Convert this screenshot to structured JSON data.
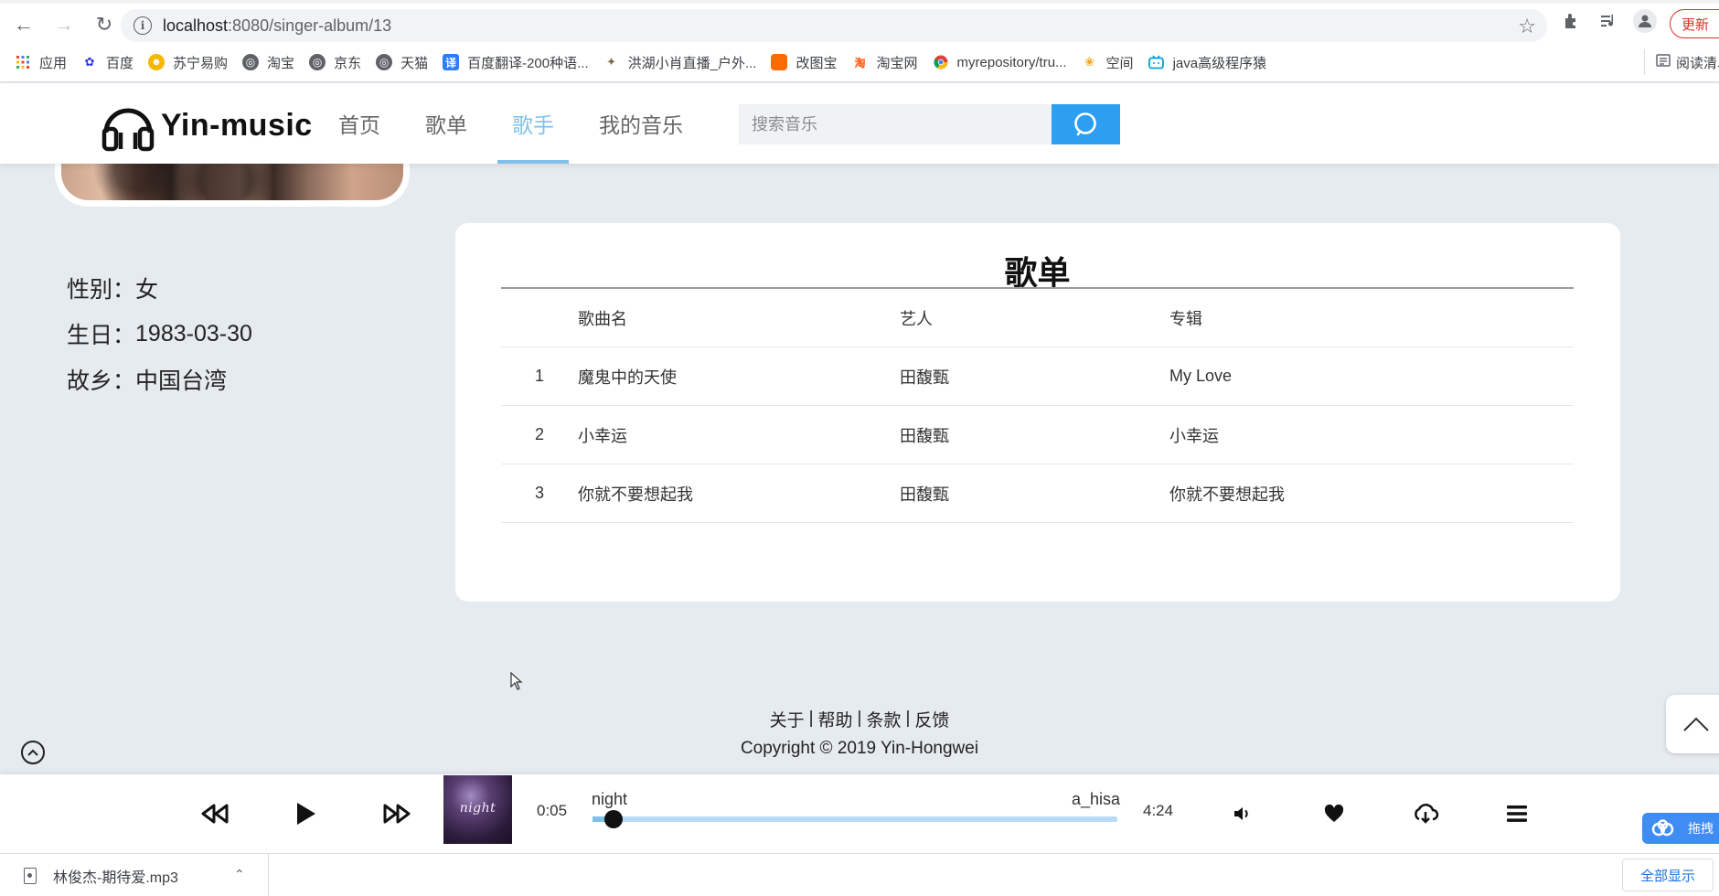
{
  "browser": {
    "url_host": "localhost",
    "url_path": ":8080/singer-album/13",
    "update_label": "更新",
    "reading_mode_label": "阅读清单",
    "bookmarks": [
      {
        "label": "应用",
        "icon": "apps-grid-icon",
        "color": "#4285f4"
      },
      {
        "label": "百度",
        "icon": "baidu-paw-icon",
        "color": "#2932e1"
      },
      {
        "label": "苏宁易购",
        "icon": "suning-lion-icon",
        "color": "#f5b800"
      },
      {
        "label": "淘宝",
        "icon": "globe-icon",
        "color": "#5f6368"
      },
      {
        "label": "京东",
        "icon": "globe-icon",
        "color": "#5f6368"
      },
      {
        "label": "天猫",
        "icon": "globe-icon",
        "color": "#5f6368"
      },
      {
        "label": "百度翻译-200种语...",
        "icon": "baidu-translate-icon",
        "color": "#2d7dfa"
      },
      {
        "label": "洪湖小肖直播_户外...",
        "icon": "bird-icon",
        "color": "#7a6a4a"
      },
      {
        "label": "改图宝",
        "icon": "gaitubao-icon",
        "color": "#ff6a00"
      },
      {
        "label": "淘宝网",
        "icon": "taobao-icon",
        "color": "#ff5000"
      },
      {
        "label": "myrepository/tru...",
        "icon": "chrome-icon",
        "color": "#db4437"
      },
      {
        "label": "空间",
        "icon": "qzone-icon",
        "color": "#f2a81d"
      },
      {
        "label": "java高级程序猿",
        "icon": "bilibili-tv-icon",
        "color": "#00a1d6"
      }
    ]
  },
  "site": {
    "logo_text": "Yin-music",
    "nav": [
      {
        "label": "首页",
        "active": false
      },
      {
        "label": "歌单",
        "active": false
      },
      {
        "label": "歌手",
        "active": true
      },
      {
        "label": "我的音乐",
        "active": false
      }
    ],
    "search_placeholder": "搜索音乐",
    "accent_color": "#7ec1ea",
    "search_button_color": "#2e9ff0"
  },
  "singer": {
    "gender_label": "性别：",
    "gender": "女",
    "birthday_label": "生日：",
    "birthday": "1983-03-30",
    "hometown_label": "故乡：",
    "hometown": "中国台湾"
  },
  "songlist": {
    "title": "歌单",
    "columns": {
      "index": "",
      "name": "歌曲名",
      "artist": "艺人",
      "album": "专辑"
    },
    "rows": [
      {
        "index": "1",
        "name": "魔鬼中的天使",
        "artist": "田馥甄",
        "album": "My Love"
      },
      {
        "index": "2",
        "name": "小幸运",
        "artist": "田馥甄",
        "album": "小幸运"
      },
      {
        "index": "3",
        "name": "你就不要想起我",
        "artist": "田馥甄",
        "album": "你就不要想起我"
      }
    ]
  },
  "footer": {
    "links": [
      "关于",
      "帮助",
      "条款",
      "反馈"
    ],
    "separator": "|",
    "copyright": "Copyright © 2019 Yin-Hongwei"
  },
  "player": {
    "cover_text": "night",
    "current_time": "0:05",
    "total_time": "4:24",
    "track_name": "night",
    "track_artist": "a_hisa",
    "progress_fraction": 0.04,
    "cloud_tab_label": "拖拽"
  },
  "downloads": {
    "file_name": "林俊杰-期待爱.mp3",
    "show_all_label": "全部显示"
  }
}
